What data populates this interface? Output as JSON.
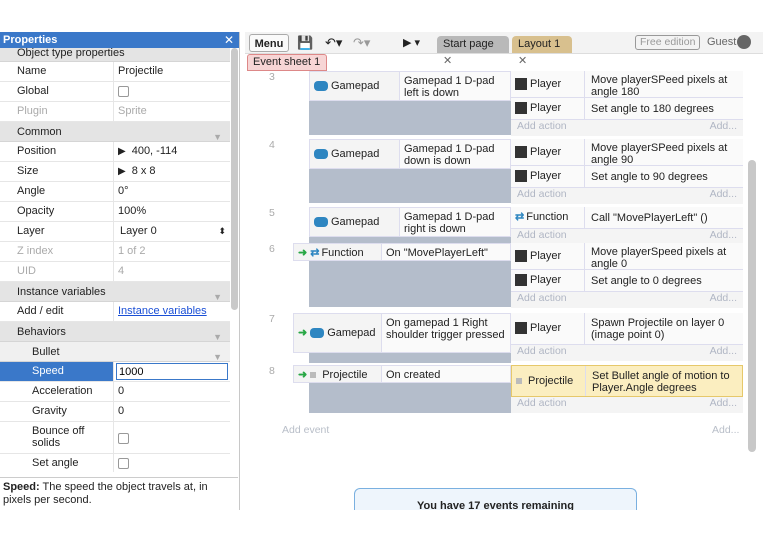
{
  "properties": {
    "title": "Properties",
    "close": "✕",
    "section_object": "Object type properties",
    "name_label": "Name",
    "name_value": "Projectile",
    "global_label": "Global",
    "plugin_label": "Plugin",
    "plugin_value": "Sprite",
    "section_common": "Common",
    "position_label": "Position",
    "position_value": "400, -114",
    "size_label": "Size",
    "size_value": "8 x 8",
    "angle_label": "Angle",
    "angle_value": "0°",
    "opacity_label": "Opacity",
    "opacity_value": "100%",
    "layer_label": "Layer",
    "layer_value": "Layer 0",
    "zindex_label": "Z index",
    "zindex_value": "1 of 2",
    "uid_label": "UID",
    "uid_value": "4",
    "section_instvars": "Instance variables",
    "addedit_label": "Add / edit",
    "addedit_link": "Instance variables",
    "section_behaviors": "Behaviors",
    "section_bullet": "Bullet",
    "speed_label": "Speed",
    "speed_value": "1000",
    "accel_label": "Acceleration",
    "accel_value": "0",
    "gravity_label": "Gravity",
    "gravity_value": "0",
    "bounce_label": "Bounce off solids",
    "setangle_label": "Set angle",
    "help_bold": "Speed:",
    "help_text": " The speed the object travels at, in pixels per second."
  },
  "toolbar": {
    "menu": "Menu",
    "tab_start": "Start page",
    "tab_layout": "Layout 1",
    "free": "Free edition",
    "guest": "Guest"
  },
  "sheet_tab": "Event sheet 1",
  "events": [
    {
      "num": "3",
      "obj": "Gamepad",
      "cond": "Gamepad 1 D-pad left is down",
      "a1_obj": "Player",
      "a1": "Move playerSPeed pixels at angle 180",
      "a2_obj": "Player",
      "a2": "Set angle to 180 degrees"
    },
    {
      "num": "4",
      "obj": "Gamepad",
      "cond": "Gamepad 1 D-pad down is down",
      "a1_obj": "Player",
      "a1": "Move playerSPeed pixels at angle 90",
      "a2_obj": "Player",
      "a2": "Set angle to 90 degrees"
    },
    {
      "num": "5",
      "obj": "Gamepad",
      "cond": "Gamepad 1 D-pad right is down",
      "a1_obj": "Function",
      "a1": "Call \"MovePlayerLeft\" ()"
    },
    {
      "num": "6",
      "obj": "Function",
      "cond": "On \"MovePlayerLeft\"",
      "a1_obj": "Player",
      "a1": "Move playerSpeed pixels at angle 0",
      "a2_obj": "Player",
      "a2": "Set angle to 0 degrees"
    },
    {
      "num": "7",
      "obj": "Gamepad",
      "cond": "On gamepad 1 Right shoulder trigger pressed",
      "a1_obj": "Player",
      "a1": "Spawn Projectile on layer 0 (image point 0)"
    },
    {
      "num": "8",
      "obj": "Projectile",
      "cond": "On created",
      "a1_obj": "Projectile",
      "a1": "Set Bullet angle of motion to Player.Angle degrees"
    }
  ],
  "add_action": "Add action",
  "add_action_r": "Add...",
  "add_event": "Add event",
  "add_event_r": "Add...",
  "remaining": "You have 17 events remaining"
}
